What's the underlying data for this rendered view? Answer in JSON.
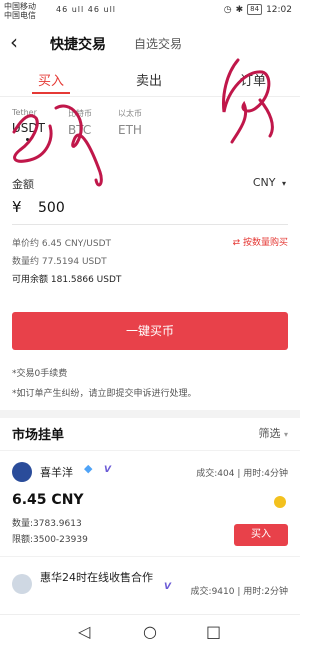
{
  "status_bar": {
    "carrier1": "中国移动",
    "carrier2": "中国电信",
    "signal_text": "46 ull 46 ull",
    "battery": "84",
    "time": "12:02"
  },
  "header": {
    "title": "快捷交易",
    "subtitle": "自选交易"
  },
  "tabs": [
    {
      "label": "买入",
      "active": true
    },
    {
      "label": "卖出",
      "active": false
    },
    {
      "label": "订单",
      "active": false
    }
  ],
  "coins": [
    {
      "cn": "Tether",
      "symbol": "USDT",
      "active": true
    },
    {
      "cn": "比特币",
      "symbol": "BTC",
      "active": false
    },
    {
      "cn": "以太币",
      "symbol": "ETH",
      "active": false
    }
  ],
  "form": {
    "amount_label": "金额",
    "currency": "CNY",
    "yen": "¥",
    "amount_value": "500",
    "unit_price": "单价约 6.45 CNY/USDT",
    "quantity": "数量约 77.5194 USDT",
    "balance": "可用余额 181.5866 USDT",
    "buy_by_qty": "按数量购买"
  },
  "buy_button": "一键买币",
  "notes": [
    "*交易0手续费",
    "*如订单产生纠纷，请立即提交申诉进行处理。"
  ],
  "market": {
    "title": "市场挂单",
    "filter": "筛选",
    "merchants": [
      {
        "name": "喜羊洋",
        "stats": "成交:404 | 用时:4分钟",
        "price": "6.45 CNY",
        "quantity": "数量:3783.9613",
        "limit": "限额:3500-23939",
        "buy_label": "买入"
      },
      {
        "name": "惠华24时在线收售合作",
        "stats": "成交:9410 | 用时:2分钟"
      }
    ]
  },
  "colors": {
    "accent": "#e8414a",
    "active_tab": "#e53935",
    "scribble": "#c0174a"
  },
  "icons": [
    "back-icon",
    "chevron-down-icon",
    "swap-icon",
    "filter-icon",
    "diamond-badge-icon",
    "vip-badge-icon",
    "payment-icon",
    "nav-back-icon",
    "nav-home-icon",
    "nav-recent-icon"
  ]
}
